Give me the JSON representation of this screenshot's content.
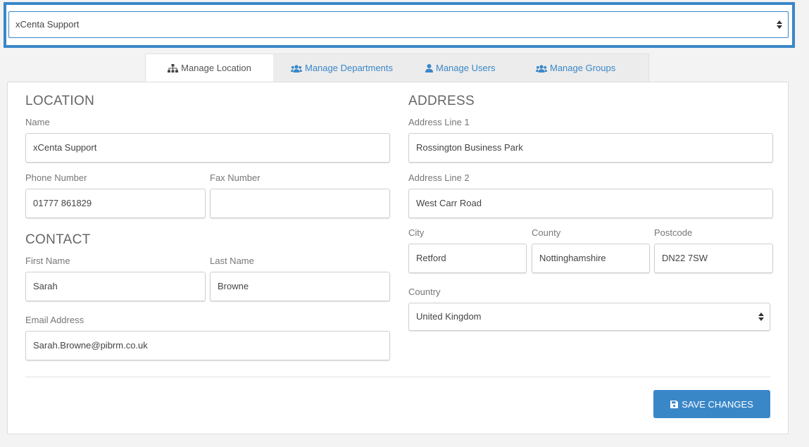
{
  "location_selector": {
    "value": "xCenta Support"
  },
  "tabs": [
    {
      "label": "Manage Location",
      "icon": "sitemap-icon",
      "active": true
    },
    {
      "label": "Manage Departments",
      "icon": "users-icon",
      "active": false
    },
    {
      "label": "Manage Users",
      "icon": "user-icon",
      "active": false
    },
    {
      "label": "Manage Groups",
      "icon": "users-icon",
      "active": false
    }
  ],
  "location": {
    "title": "LOCATION",
    "name_label": "Name",
    "name_value": "xCenta Support",
    "phone_label": "Phone Number",
    "phone_value": "01777 861829",
    "fax_label": "Fax Number",
    "fax_value": ""
  },
  "contact": {
    "title": "CONTACT",
    "first_name_label": "First Name",
    "first_name_value": "Sarah",
    "last_name_label": "Last Name",
    "last_name_value": "Browne",
    "email_label": "Email Address",
    "email_value": "Sarah.Browne@pibrm.co.uk"
  },
  "address": {
    "title": "ADDRESS",
    "line1_label": "Address Line 1",
    "line1_value": "Rossington Business Park",
    "line2_label": "Address Line 2",
    "line2_value": "West Carr Road",
    "city_label": "City",
    "city_value": "Retford",
    "county_label": "County",
    "county_value": "Nottinghamshire",
    "postcode_label": "Postcode",
    "postcode_value": "DN22 7SW",
    "country_label": "Country",
    "country_value": "United Kingdom"
  },
  "save_button": {
    "label": "SAVE CHANGES",
    "icon": "floppy-disk-icon"
  },
  "colors": {
    "accent": "#3a87c8",
    "page_bg": "#f3f3f3"
  }
}
